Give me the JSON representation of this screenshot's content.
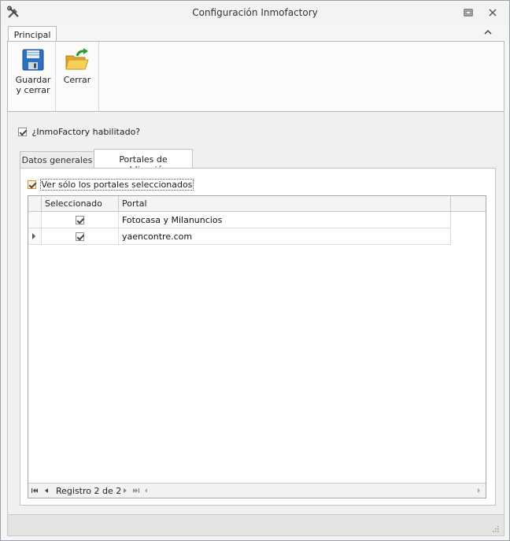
{
  "window": {
    "title": "Configuración Inmofactory",
    "icon": "tools-icon"
  },
  "ribbon": {
    "tabs": [
      {
        "label": "Principal",
        "active": true
      }
    ],
    "buttons": [
      {
        "label_line1": "Guardar",
        "label_line2": "y cerrar",
        "icon": "floppy-disk-icon"
      },
      {
        "label": "Cerrar",
        "icon": "folder-open-arrow-icon"
      }
    ]
  },
  "main": {
    "enabled_label": "¿InmoFactory habilitado?",
    "enabled_checked": true,
    "tabs": [
      {
        "label": "Datos generales",
        "active": false
      },
      {
        "label": "Portales de publicación",
        "active": true
      }
    ],
    "filter_label": "Ver sólo los portales seleccionados",
    "filter_checked": true
  },
  "grid": {
    "columns": [
      "Seleccionado",
      "Portal"
    ],
    "rows": [
      {
        "selected": true,
        "portal": "Fotocasa y Milanuncios",
        "current": false
      },
      {
        "selected": true,
        "portal": "yaencontre.com",
        "current": true
      }
    ],
    "navigator_text": "Registro 2 de 2"
  },
  "colors": {
    "accent_orange": "#e08a2c",
    "border": "#b9b9b9",
    "background": "#f0f0f0"
  }
}
